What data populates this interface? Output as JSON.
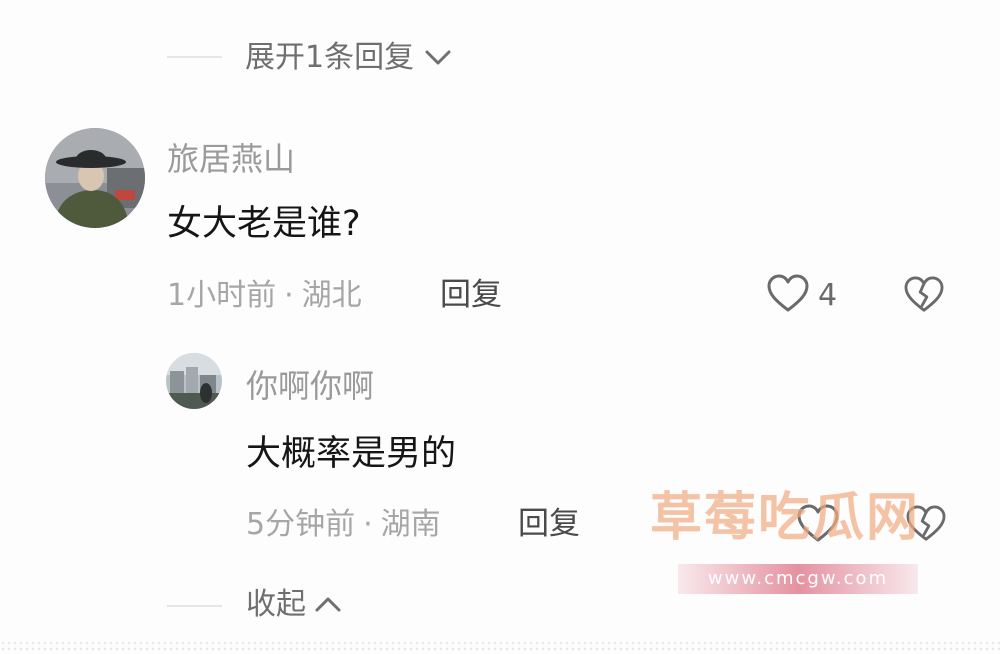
{
  "thread": {
    "expand_label": "展开1条回复",
    "collapse_label": "收起"
  },
  "comment": {
    "username": "旅居燕山",
    "text": "女大老是谁?",
    "time": "1小时前",
    "location": "湖北",
    "separator": "·",
    "reply_label": "回复",
    "like_count": "4"
  },
  "reply": {
    "username": "你啊你啊",
    "text": "大概率是男的",
    "time": "5分钟前",
    "location": "湖南",
    "separator": "·",
    "reply_label": "回复"
  },
  "watermark": {
    "text": "草莓吃瓜网",
    "url": "www.cmcgw.com"
  },
  "icons": {
    "expand": "chevron-down-icon",
    "collapse": "chevron-up-icon",
    "like": "heart-outline-icon",
    "dislike": "broken-heart-icon"
  },
  "colors": {
    "background": "#fdfdfd",
    "username": "#9a9a9a",
    "comment_text": "#161616",
    "meta": "#a6a6a6",
    "watermark": "#f0ac82"
  }
}
